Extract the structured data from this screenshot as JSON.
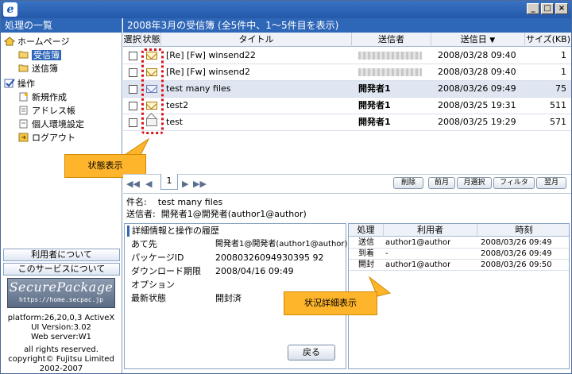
{
  "window": {
    "logo_letter": "e",
    "min": "_",
    "max": "□",
    "close": "×"
  },
  "sidebar": {
    "title": "処理の一覧",
    "tree": [
      {
        "label": "ホームページ",
        "icon": "home-icon",
        "selected": false
      },
      {
        "label": "受信簿",
        "icon": "open-folder-icon",
        "selected": true
      },
      {
        "label": "送信簿",
        "icon": "folder-icon",
        "selected": false
      },
      {
        "label": "操作",
        "icon": "check-icon",
        "selected": false
      },
      {
        "label": "新規作成",
        "icon": "new-document-icon",
        "selected": false
      },
      {
        "label": "アドレス帳",
        "icon": "address-book-icon",
        "selected": false
      },
      {
        "label": "個人環境設定",
        "icon": "settings-document-icon",
        "selected": false
      },
      {
        "label": "ログアウト",
        "icon": "logout-icon",
        "selected": false
      }
    ],
    "buttons": {
      "about_user": "利用者について",
      "about_service": "このサービスについて"
    },
    "logo": {
      "line1": "SecurePackage",
      "line2": "https://home.secpac.jp"
    },
    "info": {
      "platform": "platform:26,20,0,3 ActiveX",
      "ui_version": "UI Version:3.02",
      "web_server": "Web server:W1",
      "rights": "all rights reserved.",
      "copyright": "copyright© Fujitsu Limited",
      "years": "2002-2007"
    }
  },
  "main": {
    "title": "2008年3月の受信簿 (全5件中、1〜5件目を表示)",
    "columns": {
      "select": "選択",
      "status": "状態",
      "title": "タイトル",
      "sender": "送信者",
      "sent_date": "送信日",
      "sort_arrow": "▼",
      "size": "サイズ(KB)"
    },
    "rows": [
      {
        "title": "[Re] [Fw] winsend22",
        "sender": "",
        "date": "2008/03/28 09:40",
        "size": "1",
        "bold": false,
        "selected": false,
        "icon": "mail-icon"
      },
      {
        "title": "[Re] [Fw] winsend2",
        "sender": "",
        "date": "2008/03/28 09:40",
        "size": "1",
        "bold": false,
        "selected": false,
        "icon": "mail-icon"
      },
      {
        "title": "test many files",
        "sender": "開発者1",
        "date": "2008/03/26 09:49",
        "size": "75",
        "bold": false,
        "selected": true,
        "icon": "mail-multi-icon"
      },
      {
        "title": "test2",
        "sender": "開発者1",
        "date": "2008/03/25 19:31",
        "size": "511",
        "bold": true,
        "selected": false,
        "icon": "mail-icon"
      },
      {
        "title": "test",
        "sender": "開発者1",
        "date": "2008/03/25 19:29",
        "size": "571",
        "bold": true,
        "selected": false,
        "icon": "mail-open-icon"
      }
    ]
  },
  "callouts": {
    "status": "状態表示",
    "detail": "状況詳細表示"
  },
  "pager": {
    "first": "◀◀",
    "prev": "◀",
    "page": "1",
    "next": "▶",
    "last": "▶▶",
    "delete": "削除",
    "prev_month": "前月",
    "month_select": "月選択",
    "filter": "フィルタ",
    "next_month": "翌月"
  },
  "detail": {
    "subject_label": "件名:",
    "subject": "test many files",
    "sender_label": "送信者:",
    "sender": "開発者1@開発者(author1@author)"
  },
  "info": {
    "title": "詳細情報と操作の履歴",
    "rows": [
      {
        "label": "あて先",
        "value": "開発者1@開発者(author1@author)"
      },
      {
        "label": "パッケージID",
        "value": "20080326094930395 92"
      },
      {
        "label": "ダウンロード期限",
        "value": "2008/04/16 09:49"
      },
      {
        "label": "オプション",
        "value": ""
      },
      {
        "label": "最新状態",
        "value": "開封済"
      }
    ],
    "back_button": "戻る"
  },
  "history": {
    "columns": {
      "action": "処理",
      "user": "利用者",
      "time": "時刻"
    },
    "rows": [
      {
        "action": "送信",
        "user": "author1@author",
        "time": "2008/03/26 09:49"
      },
      {
        "action": "到着",
        "user": "-",
        "time": "2008/03/26 09:49"
      },
      {
        "action": "開封",
        "user": "author1@author",
        "time": "2008/03/26 09:50"
      }
    ]
  }
}
